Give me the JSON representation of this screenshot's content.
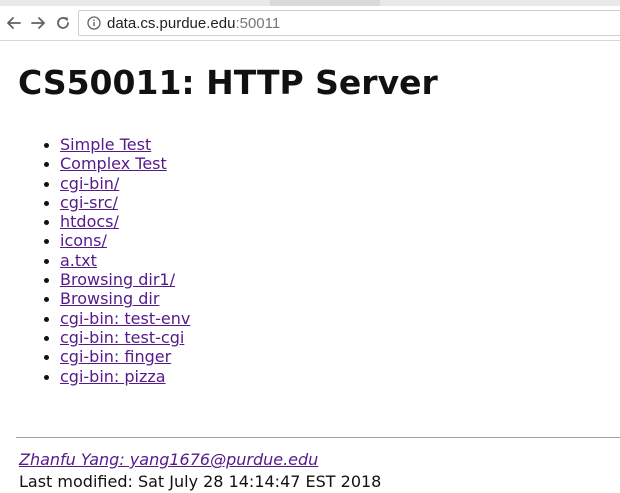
{
  "browser": {
    "back_icon": "arrow-left-icon",
    "forward_icon": "arrow-right-icon",
    "reload_icon": "reload-icon",
    "info_icon": "info-icon",
    "url_host": "data.cs.purdue.edu",
    "url_port": ":50011"
  },
  "page": {
    "title": "CS50011: HTTP Server",
    "links": [
      {
        "label": "Simple Test"
      },
      {
        "label": "Complex Test"
      },
      {
        "label": "cgi-bin/"
      },
      {
        "label": "cgi-src/"
      },
      {
        "label": "htdocs/"
      },
      {
        "label": "icons/"
      },
      {
        "label": "a.txt"
      },
      {
        "label": "Browsing dir1/"
      },
      {
        "label": "Browsing dir"
      },
      {
        "label": "cgi-bin: test-env"
      },
      {
        "label": "cgi-bin: test-cgi"
      },
      {
        "label": "cgi-bin: finger"
      },
      {
        "label": "cgi-bin: pizza"
      }
    ],
    "footer": {
      "author_link": "Zhanfu Yang: yang1676@purdue.edu",
      "last_modified": "Last modified: Sat July 28 14:14:47 EST 2018"
    }
  },
  "colors": {
    "link_visited": "#551a8b",
    "text": "#111111",
    "separator": "#a0a0a0"
  }
}
